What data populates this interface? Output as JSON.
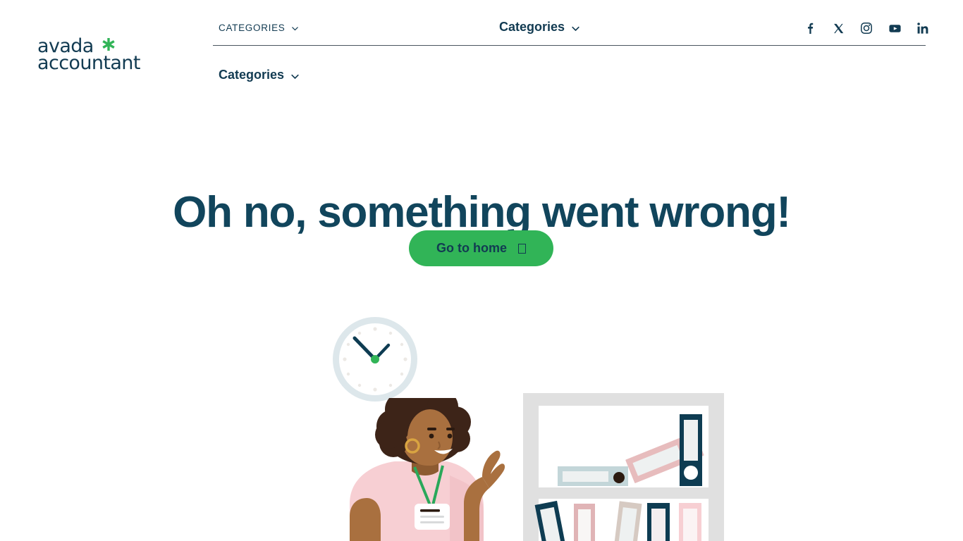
{
  "brand": {
    "line1": "avada",
    "line2": "accountant",
    "star_icon": "asterisk-icon",
    "star_color": "#31b457",
    "text_color": "#123b52"
  },
  "header": {
    "nav_top_left": {
      "label": "CATEGORIES",
      "chevron": "chevron-down-icon"
    },
    "nav_top_center": {
      "label": "Categories",
      "chevron": "chevron-down-icon"
    },
    "nav_second": {
      "label": "Categories",
      "chevron": "chevron-down-icon"
    },
    "social": [
      {
        "name": "facebook-icon",
        "label": "f"
      },
      {
        "name": "x-twitter-icon",
        "label": "X"
      },
      {
        "name": "instagram-icon",
        "label": "Instagram"
      },
      {
        "name": "youtube-icon",
        "label": "YouTube"
      },
      {
        "name": "linkedin-icon",
        "label": "in"
      }
    ]
  },
  "hero": {
    "headline": "Oh no, something went wrong!",
    "headline_color": "#11455c",
    "button": {
      "label": "Go to home",
      "icon": "missing-glyph-box-icon",
      "background": "#31b457",
      "text_color": "#123b52"
    }
  },
  "illustration": {
    "name": "404-office-illustration",
    "clock": {
      "name": "wall-clock",
      "ring_color": "#dde7eb",
      "face_color": "#ffffff",
      "hand_color": "#0e3c52",
      "center_dot_color": "#31b457",
      "marker_color": "#ece9e5"
    },
    "person": {
      "name": "woman-with-badge",
      "hair_color": "#3d2418",
      "skin_color": "#a9703f",
      "shirt_color": "#f7cfd3",
      "lanyard_color": "#2aa85a",
      "badge_color": "#ffffff",
      "earring_color": "#d9a441"
    },
    "shelf": {
      "name": "bookshelf-with-binders",
      "frame_color": "#e0e0e0",
      "interior_color": "#ffffff",
      "binders_top": [
        {
          "name": "binder-horizontal-blue",
          "color": "#c3d6d9"
        },
        {
          "name": "binder-diagonal-pink",
          "color": "#e7bcbd"
        },
        {
          "name": "binder-upright-navy",
          "color": "#0e3c52"
        }
      ],
      "binders_bottom": [
        {
          "name": "binder-navy-tilted",
          "color": "#0e3c52"
        },
        {
          "name": "binder-pink",
          "color": "#e0b4b6"
        },
        {
          "name": "binder-beige-tilted",
          "color": "#d6cac2"
        },
        {
          "name": "binder-navy",
          "color": "#0e3c52"
        },
        {
          "name": "binder-light-pink",
          "color": "#f7cfd3"
        }
      ]
    }
  }
}
